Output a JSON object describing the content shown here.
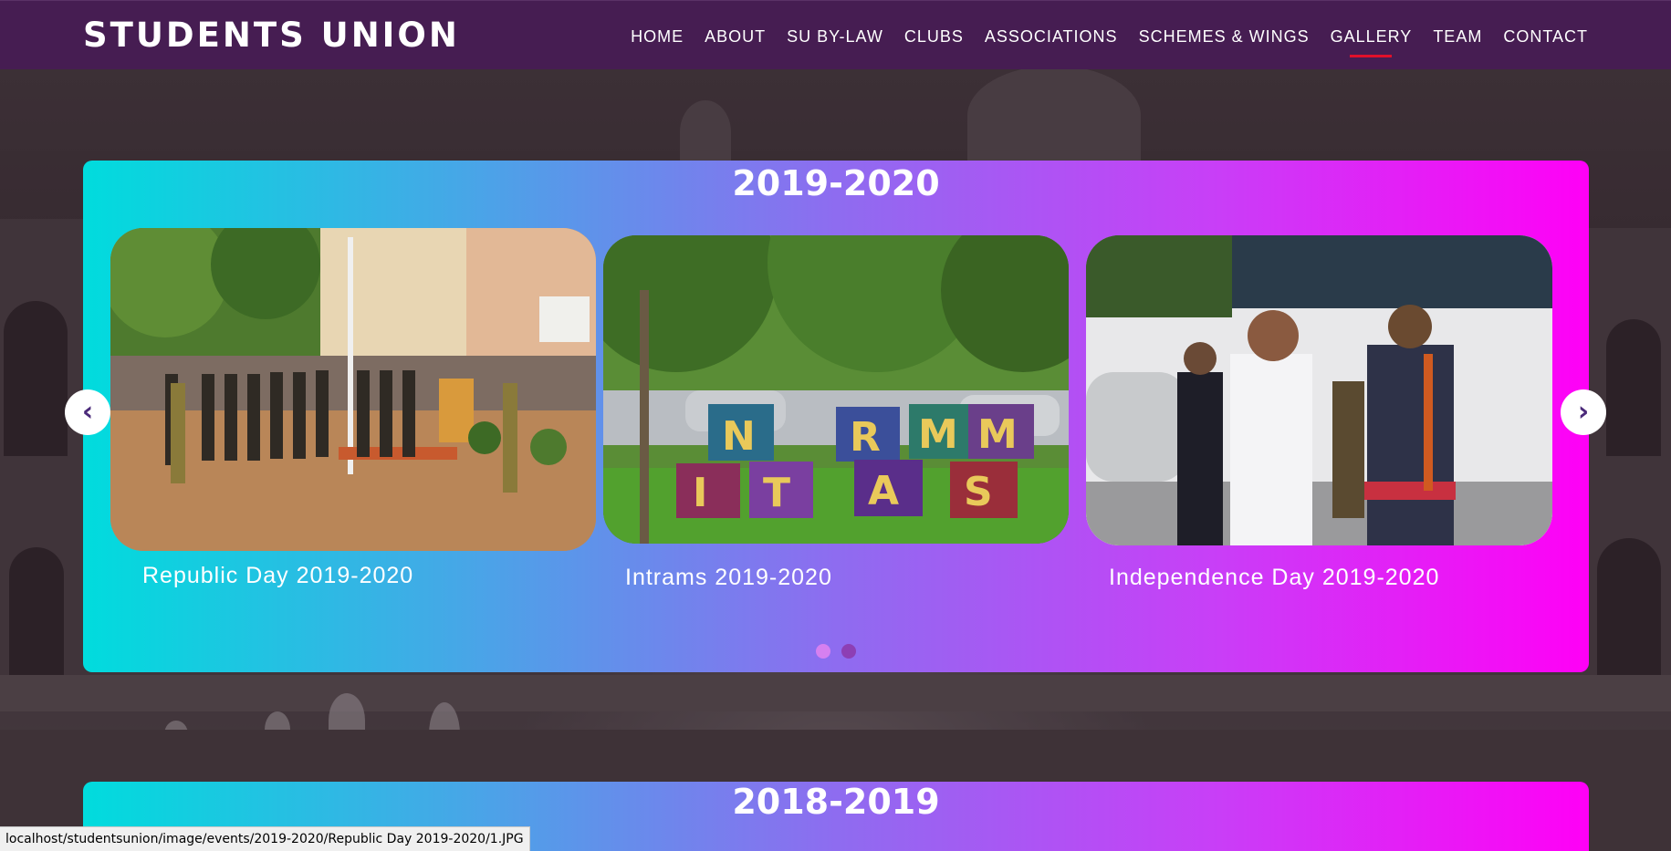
{
  "brand": "STUDENTS UNION",
  "nav": [
    {
      "label": "HOME"
    },
    {
      "label": "ABOUT"
    },
    {
      "label": "SU BY-LAW"
    },
    {
      "label": "CLUBS"
    },
    {
      "label": "ASSOCIATIONS"
    },
    {
      "label": "SCHEMES & WINGS"
    },
    {
      "label": "GALLERY",
      "active": true
    },
    {
      "label": "TEAM"
    },
    {
      "label": "CONTACT"
    }
  ],
  "gallery": [
    {
      "year": "2019-2020",
      "items": [
        {
          "caption": "Republic Day 2019-2020",
          "image": "parade-photo"
        },
        {
          "caption": "Intrams 2019-2020",
          "image": "letter-blocks-photo"
        },
        {
          "caption": "Independence Day 2019-2020",
          "image": "handshake-photo"
        }
      ],
      "carousel": {
        "prev_icon": "‹",
        "next_icon": "›",
        "slides": 2,
        "active_slide": 1
      }
    },
    {
      "year": "2018-2019"
    }
  ],
  "status_bar": "localhost/studentsunion/image/events/2019-2020/Republic Day 2019-2020/1.JPG",
  "colors": {
    "navbar": "#461d52",
    "gradient_start": "#00dcdd",
    "gradient_end": "#ff00f6",
    "active_underline": "#e0102a",
    "dot_active": "#d680f0",
    "dot_inactive": "#8d3fb4"
  }
}
